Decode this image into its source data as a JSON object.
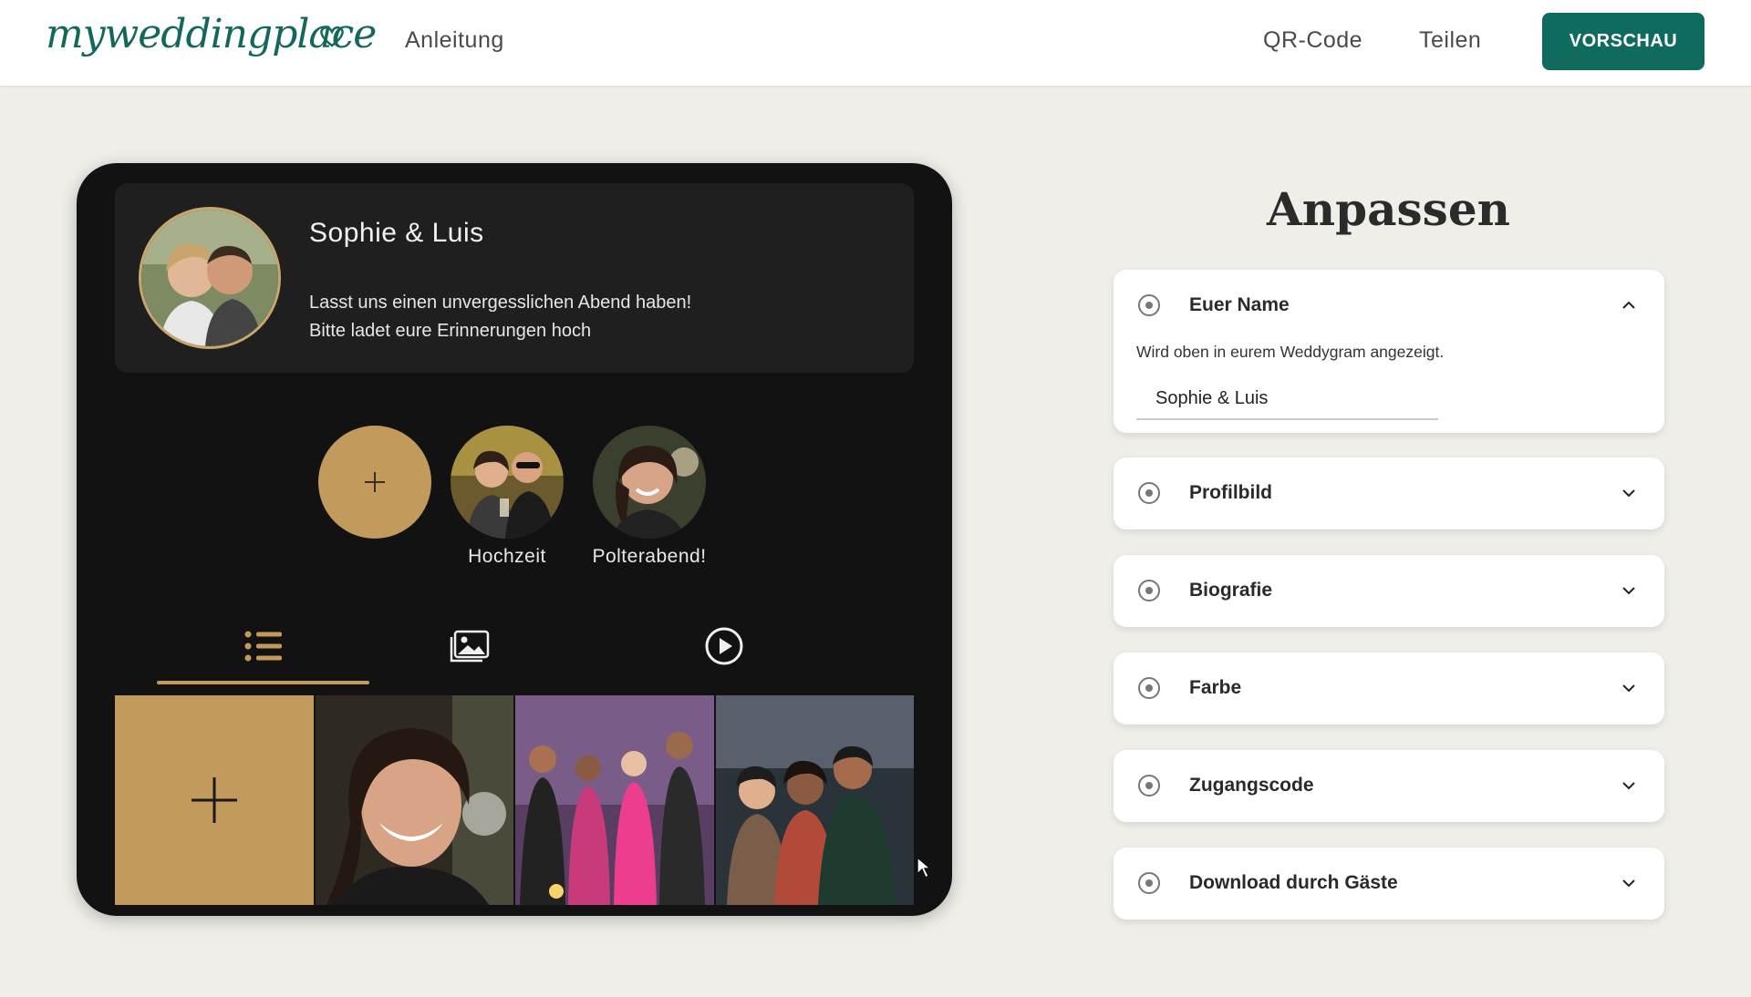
{
  "header": {
    "logo_text": "myweddingplace",
    "nav": {
      "anleitung": "Anleitung",
      "qr_code": "QR-Code",
      "teilen": "Teilen"
    },
    "preview_button": "VORSCHAU",
    "accent_color": "#0f6b5e"
  },
  "preview": {
    "couple_name": "Sophie & Luis",
    "bio_line1": "Lasst uns einen unvergesslichen Abend haben!",
    "bio_line2": "Bitte ladet eure Erinnerungen hoch",
    "gold_color": "#c29a5c",
    "stories": [
      {
        "label": "Hochzeit"
      },
      {
        "label": "Polterabend!"
      }
    ],
    "tabs": [
      "list-icon",
      "gallery-icon",
      "video-play-icon"
    ],
    "active_tab": "list-icon"
  },
  "customize": {
    "title": "Anpassen",
    "sections": [
      {
        "title": "Euer Name",
        "expanded": true,
        "description": "Wird oben in eurem Weddygram angezeigt.",
        "value": "Sophie & Luis"
      },
      {
        "title": "Profilbild",
        "expanded": false
      },
      {
        "title": "Biografie",
        "expanded": false
      },
      {
        "title": "Farbe",
        "expanded": false
      },
      {
        "title": "Zugangscode",
        "expanded": false
      },
      {
        "title": "Download durch Gäste",
        "expanded": false
      }
    ]
  }
}
